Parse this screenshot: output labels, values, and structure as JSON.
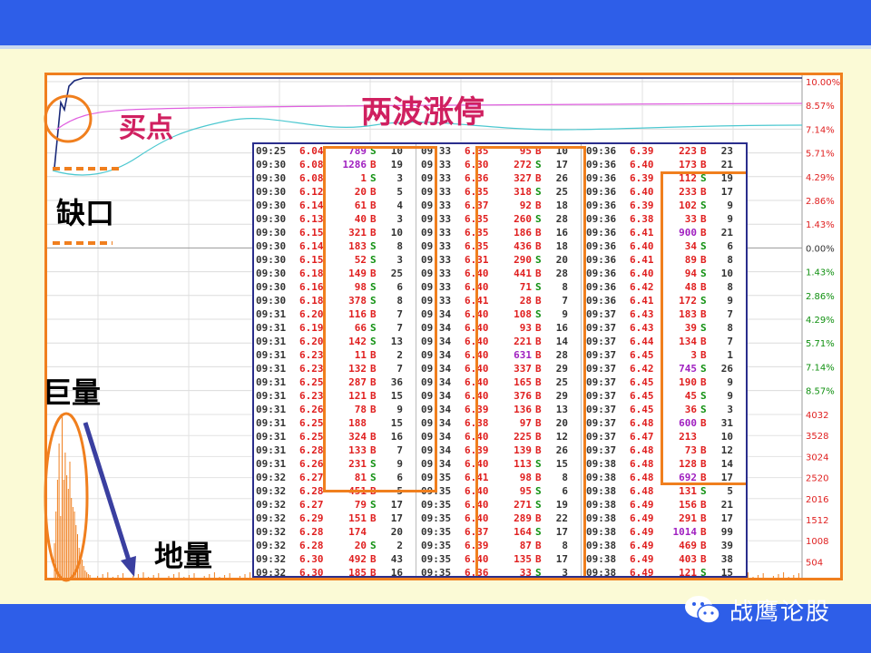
{
  "annotations": {
    "buy_point": "买点",
    "two_waves": "两波涨停",
    "gap": "缺口",
    "huge_volume": "巨量",
    "ground_volume": "地量"
  },
  "watermark": {
    "text": "战鹰论股",
    "icon": "wechat-icon"
  },
  "colors": {
    "accent": "#f07f1e",
    "band": "#2e5ee8",
    "up": "#e02020",
    "down": "#109010",
    "avg_line": "#e060e0",
    "price_line": "#4cc8d0",
    "big_trade": "#a020c0"
  },
  "chart_data": {
    "type": "line",
    "title": "",
    "xlabel": "",
    "ylabel": "",
    "price_pct_ticks": [
      "10.00%",
      "8.57%",
      "7.14%",
      "5.71%",
      "4.29%",
      "2.86%",
      "1.43%",
      "0.00%",
      "1.43%",
      "2.86%",
      "4.29%",
      "5.71%",
      "7.14%",
      "8.57%"
    ],
    "volume_ticks": [
      "4032",
      "3528",
      "3024",
      "2520",
      "2016",
      "1512",
      "1008",
      "504"
    ],
    "series": [],
    "ticker": {
      "columns": [
        {
          "rows": [
            [
              "09:25",
              "6.04",
              "789",
              "S",
              "10"
            ],
            [
              "09:30",
              "6.08",
              "1286",
              "B",
              "19"
            ],
            [
              "09:30",
              "6.08",
              "1",
              "S",
              "3"
            ],
            [
              "09:30",
              "6.12",
              "20",
              "B",
              "5"
            ],
            [
              "09:30",
              "6.14",
              "61",
              "B",
              "4"
            ],
            [
              "09:30",
              "6.13",
              "40",
              "B",
              "3"
            ],
            [
              "09:30",
              "6.15",
              "321",
              "B",
              "10"
            ],
            [
              "09:30",
              "6.14",
              "183",
              "S",
              "8"
            ],
            [
              "09:30",
              "6.15",
              "52",
              "S",
              "3"
            ],
            [
              "09:30",
              "6.18",
              "149",
              "B",
              "25"
            ],
            [
              "09:30",
              "6.16",
              "98",
              "S",
              "6"
            ],
            [
              "09:30",
              "6.18",
              "378",
              "S",
              "8"
            ],
            [
              "09:31",
              "6.20",
              "116",
              "B",
              "7"
            ],
            [
              "09:31",
              "6.19",
              "66",
              "S",
              "7"
            ],
            [
              "09:31",
              "6.20",
              "142",
              "S",
              "13"
            ],
            [
              "09:31",
              "6.23",
              "11",
              "B",
              "2"
            ],
            [
              "09:31",
              "6.23",
              "132",
              "B",
              "7"
            ],
            [
              "09:31",
              "6.25",
              "287",
              "B",
              "36"
            ],
            [
              "09:31",
              "6.23",
              "121",
              "B",
              "15"
            ],
            [
              "09:31",
              "6.26",
              "78",
              "B",
              "9"
            ],
            [
              "09:31",
              "6.25",
              "188",
              "",
              "15"
            ],
            [
              "09:31",
              "6.25",
              "324",
              "B",
              "16"
            ],
            [
              "09:31",
              "6.28",
              "133",
              "B",
              "7"
            ],
            [
              "09:31",
              "6.26",
              "231",
              "S",
              "9"
            ],
            [
              "09:32",
              "6.27",
              "81",
              "S",
              "6"
            ],
            [
              "09:32",
              "6.28",
              "451",
              "B",
              "5"
            ],
            [
              "09:32",
              "6.27",
              "79",
              "S",
              "17"
            ],
            [
              "09:32",
              "6.29",
              "151",
              "B",
              "17"
            ],
            [
              "09:32",
              "6.28",
              "174",
              "",
              "20"
            ],
            [
              "09:32",
              "6.28",
              "20",
              "S",
              "2"
            ],
            [
              "09:32",
              "6.30",
              "492",
              "B",
              "43"
            ],
            [
              "09:32",
              "6.30",
              "185",
              "B",
              "16"
            ]
          ]
        },
        {
          "rows": [
            [
              "09:33",
              "6.35",
              "95",
              "B",
              "10"
            ],
            [
              "09:33",
              "6.30",
              "272",
              "S",
              "17"
            ],
            [
              "09:33",
              "6.36",
              "327",
              "B",
              "26"
            ],
            [
              "09:33",
              "6.35",
              "318",
              "S",
              "25"
            ],
            [
              "09:33",
              "6.37",
              "92",
              "B",
              "18"
            ],
            [
              "09:33",
              "6.35",
              "260",
              "S",
              "28"
            ],
            [
              "09:33",
              "6.35",
              "186",
              "B",
              "16"
            ],
            [
              "09:33",
              "6.35",
              "436",
              "B",
              "18"
            ],
            [
              "09:33",
              "6.31",
              "290",
              "S",
              "20"
            ],
            [
              "09:33",
              "6.40",
              "441",
              "B",
              "28"
            ],
            [
              "09:33",
              "6.40",
              "71",
              "S",
              "8"
            ],
            [
              "09:33",
              "6.41",
              "28",
              "B",
              "7"
            ],
            [
              "09:34",
              "6.40",
              "108",
              "S",
              "9"
            ],
            [
              "09:34",
              "6.40",
              "93",
              "B",
              "16"
            ],
            [
              "09:34",
              "6.40",
              "221",
              "B",
              "14"
            ],
            [
              "09:34",
              "6.40",
              "631",
              "B",
              "28"
            ],
            [
              "09:34",
              "6.40",
              "337",
              "B",
              "29"
            ],
            [
              "09:34",
              "6.40",
              "165",
              "B",
              "25"
            ],
            [
              "09:34",
              "6.40",
              "376",
              "B",
              "29"
            ],
            [
              "09:34",
              "6.39",
              "136",
              "B",
              "13"
            ],
            [
              "09:34",
              "6.38",
              "97",
              "B",
              "20"
            ],
            [
              "09:34",
              "6.40",
              "225",
              "B",
              "12"
            ],
            [
              "09:34",
              "6.39",
              "139",
              "B",
              "26"
            ],
            [
              "09:34",
              "6.40",
              "113",
              "S",
              "15"
            ],
            [
              "09:35",
              "6.41",
              "98",
              "B",
              "8"
            ],
            [
              "09:35",
              "6.40",
              "95",
              "S",
              "6"
            ],
            [
              "09:35",
              "6.40",
              "271",
              "S",
              "19"
            ],
            [
              "09:35",
              "6.40",
              "289",
              "B",
              "22"
            ],
            [
              "09:35",
              "6.37",
              "164",
              "S",
              "17"
            ],
            [
              "09:35",
              "6.39",
              "87",
              "B",
              "8"
            ],
            [
              "09:35",
              "6.40",
              "135",
              "B",
              "17"
            ],
            [
              "09:35",
              "6.36",
              "33",
              "S",
              "3"
            ]
          ]
        },
        {
          "rows": [
            [
              "09:36",
              "6.39",
              "223",
              "B",
              "23"
            ],
            [
              "09:36",
              "6.40",
              "173",
              "B",
              "21"
            ],
            [
              "09:36",
              "6.39",
              "112",
              "S",
              "19"
            ],
            [
              "09:36",
              "6.40",
              "233",
              "B",
              "17"
            ],
            [
              "09:36",
              "6.39",
              "102",
              "S",
              "9"
            ],
            [
              "09:36",
              "6.38",
              "33",
              "B",
              "9"
            ],
            [
              "09:36",
              "6.41",
              "900",
              "B",
              "21"
            ],
            [
              "09:36",
              "6.40",
              "34",
              "S",
              "6"
            ],
            [
              "09:36",
              "6.41",
              "89",
              "B",
              "8"
            ],
            [
              "09:36",
              "6.40",
              "94",
              "S",
              "10"
            ],
            [
              "09:36",
              "6.42",
              "48",
              "B",
              "8"
            ],
            [
              "09:36",
              "6.41",
              "172",
              "S",
              "9"
            ],
            [
              "09:37",
              "6.43",
              "183",
              "B",
              "7"
            ],
            [
              "09:37",
              "6.43",
              "39",
              "S",
              "8"
            ],
            [
              "09:37",
              "6.44",
              "134",
              "B",
              "7"
            ],
            [
              "09:37",
              "6.45",
              "3",
              "B",
              "1"
            ],
            [
              "09:37",
              "6.42",
              "745",
              "S",
              "26"
            ],
            [
              "09:37",
              "6.45",
              "190",
              "B",
              "9"
            ],
            [
              "09:37",
              "6.45",
              "45",
              "S",
              "9"
            ],
            [
              "09:37",
              "6.45",
              "36",
              "S",
              "3"
            ],
            [
              "09:37",
              "6.48",
              "600",
              "B",
              "31"
            ],
            [
              "09:37",
              "6.47",
              "213",
              "",
              "10"
            ],
            [
              "09:37",
              "6.48",
              "73",
              "B",
              "12"
            ],
            [
              "09:38",
              "6.48",
              "128",
              "B",
              "14"
            ],
            [
              "09:38",
              "6.48",
              "692",
              "B",
              "17"
            ],
            [
              "09:38",
              "6.48",
              "131",
              "S",
              "5"
            ],
            [
              "09:38",
              "6.49",
              "156",
              "B",
              "21"
            ],
            [
              "09:38",
              "6.49",
              "291",
              "B",
              "17"
            ],
            [
              "09:38",
              "6.49",
              "1014",
              "B",
              "99"
            ],
            [
              "09:38",
              "6.49",
              "469",
              "B",
              "39"
            ],
            [
              "09:38",
              "6.49",
              "403",
              "B",
              "38"
            ],
            [
              "09:38",
              "6.49",
              "121",
              "S",
              "15"
            ]
          ]
        }
      ]
    }
  }
}
